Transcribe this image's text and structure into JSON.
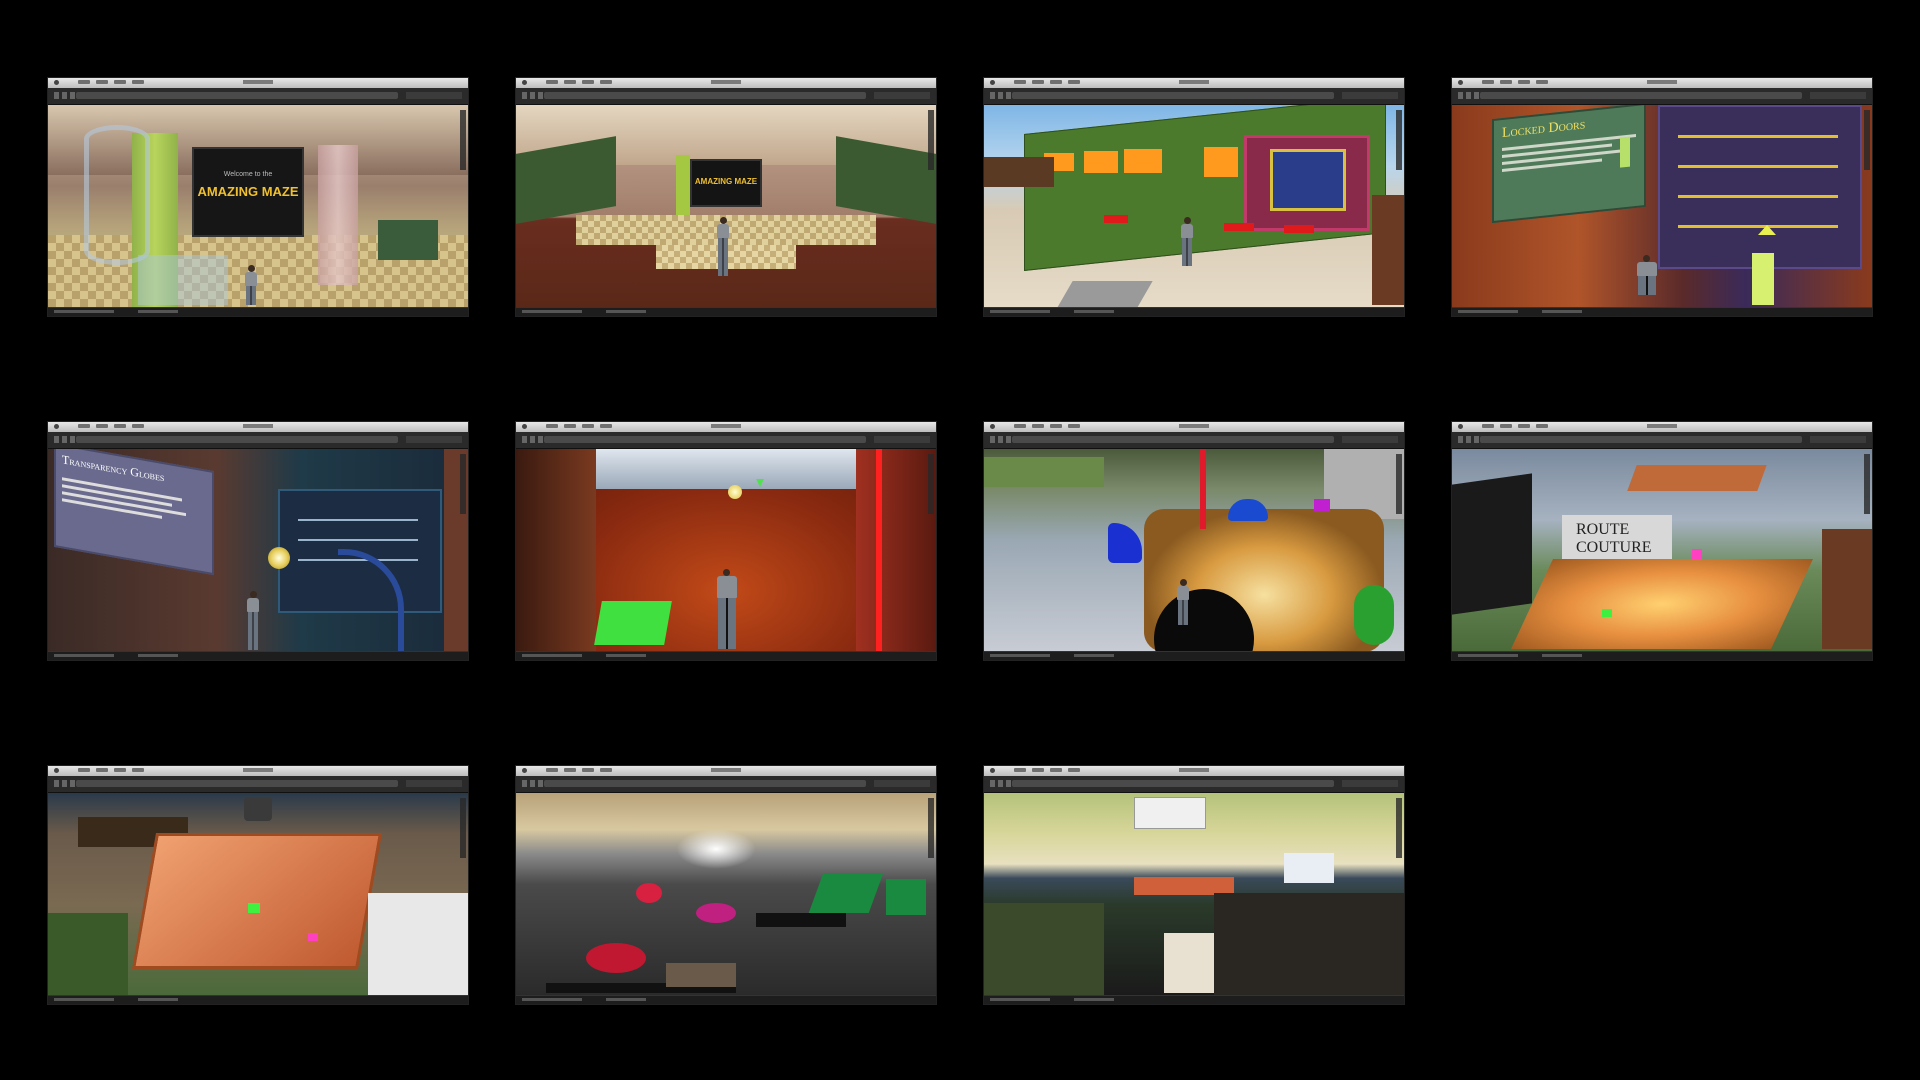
{
  "gallery": {
    "background": "#000000",
    "screenshots": [
      {
        "id": "amazing-maze-entrance-a",
        "sign_title": "AMAZING MAZE",
        "sign_caption": "Welcome to the"
      },
      {
        "id": "amazing-maze-entrance-b",
        "sign_title": "AMAZING MAZE"
      },
      {
        "id": "green-wall-room"
      },
      {
        "id": "locked-doors",
        "sign_title": "Locked Doors"
      },
      {
        "id": "transparency-globes",
        "sign_title": "Transparency Globes"
      },
      {
        "id": "red-orange-room"
      },
      {
        "id": "maze-overhead"
      },
      {
        "id": "couture-shop",
        "sign_title": "ROUTE\nCOUTURE"
      },
      {
        "id": "maze-block-overhead"
      },
      {
        "id": "sunset-overview"
      },
      {
        "id": "island-overview"
      }
    ]
  }
}
